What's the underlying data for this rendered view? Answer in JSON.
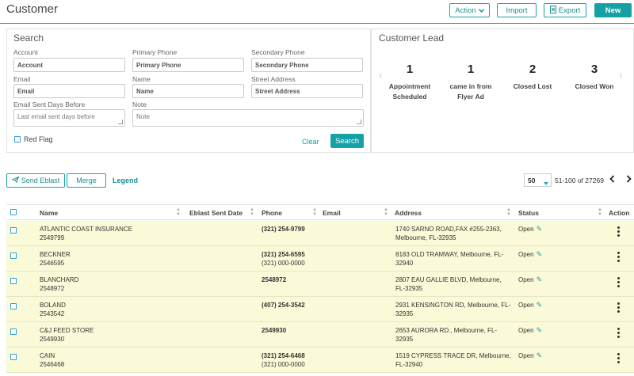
{
  "header": {
    "title": "Customer",
    "action_label": "Action",
    "import_label": "Import",
    "export_label": "Export",
    "new_label": "New",
    "accent": "#14a0a5"
  },
  "search": {
    "title": "Search",
    "account_label": "Account",
    "account_placeholder": "Account",
    "primary_phone_label": "Primary Phone",
    "primary_phone_placeholder": "Primary Phone",
    "secondary_phone_label": "Secondary Phone",
    "secondary_phone_placeholder": "Secondary Phone",
    "email_label": "Email",
    "email_placeholder": "Email",
    "name_label": "Name",
    "name_placeholder": "Name",
    "street_label": "Street Address",
    "street_placeholder": "Street Address",
    "days_label": "Email Sent Days Before",
    "days_placeholder": "Last email sent days before",
    "note_label": "Note",
    "note_placeholder": "Note",
    "red_flag_label": "Red Flag",
    "clear_label": "Clear",
    "search_label": "Search"
  },
  "lead": {
    "title": "Customer Lead",
    "items": [
      {
        "count": "1",
        "line1": "Appointment",
        "line2": "Scheduled"
      },
      {
        "count": "1",
        "line1": "came in from",
        "line2": "Flyer Ad"
      },
      {
        "count": "2",
        "line1": "Closed Lost",
        "line2": ""
      },
      {
        "count": "3",
        "line1": "Closed Won",
        "line2": ""
      }
    ]
  },
  "toolbar": {
    "send_eblast_label": "Send Eblast",
    "merge_label": "Merge",
    "legend_label": "Legend",
    "page_size": "50",
    "range_text": "51-100 of 27269"
  },
  "table": {
    "columns": {
      "name": "Name",
      "eblast": "Eblast Sent Date",
      "phone": "Phone",
      "email": "Email",
      "address": "Address",
      "status": "Status",
      "action": "Action"
    },
    "rows": [
      {
        "name": "ATLANTIC COAST INSURANCE",
        "account": "2549799",
        "phone1": "(321) 254-9799",
        "phone2": "",
        "addr1": "1740 SARNO ROAD,FAX #255-2363,",
        "addr2": "Melbourne, FL-32935",
        "status": "Open"
      },
      {
        "name": "BECKNER",
        "account": "2546595",
        "phone1": "(321) 254-6595",
        "phone2": "(321) 000-0000",
        "addr1": "8183 OLD TRAMWAY, Melbourne, FL-",
        "addr2": "32940",
        "status": "Open"
      },
      {
        "name": "BLANCHARD",
        "account": "2548972",
        "phone1": "2548972",
        "phone2": "",
        "addr1": "2807 EAU GALLIE BLVD, Melbourne,",
        "addr2": "FL-32935",
        "status": "Open"
      },
      {
        "name": "BOLAND",
        "account": "2543542",
        "phone1": "(407) 254-3542",
        "phone2": "",
        "addr1": "2931 KENSINGTON RD, Melbourne, FL-",
        "addr2": "32935",
        "status": "Open"
      },
      {
        "name": "C&J FEED STORE",
        "account": "2549930",
        "phone1": "2549930",
        "phone2": "",
        "addr1": "2653 AURORA RD., Melbourne, FL-",
        "addr2": "32935",
        "status": "Open"
      },
      {
        "name": "CAIN",
        "account": "2546468",
        "phone1": "(321) 254-6468",
        "phone2": "(321) 000-0000",
        "addr1": "1519 CYPRESS TRACE DR, Melbourne,",
        "addr2": "FL-32940",
        "status": "Open"
      }
    ]
  }
}
